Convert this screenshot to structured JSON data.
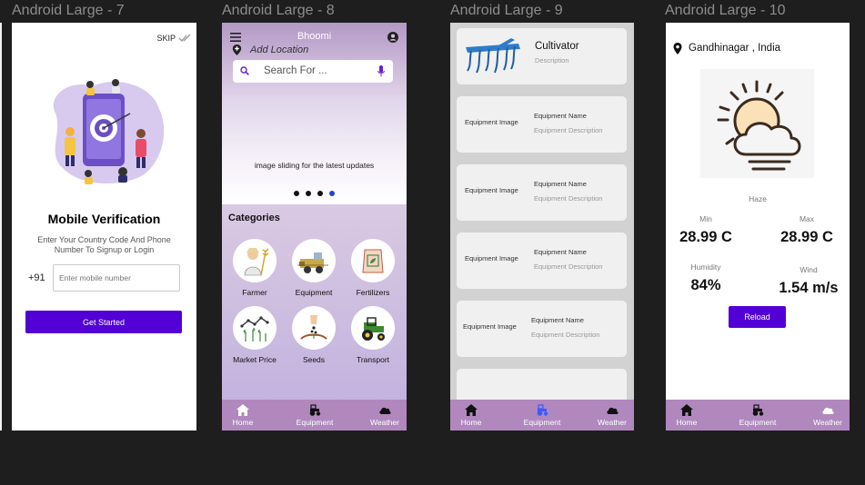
{
  "frames": {
    "f7": {
      "title": "Android Large - 7"
    },
    "f8": {
      "title": "Android Large - 8"
    },
    "f9": {
      "title": "Android Large - 9"
    },
    "f10": {
      "title": "Android Large - 10"
    }
  },
  "verification": {
    "skip_label": "SKIP",
    "heading": "Mobile Verification",
    "subtitle": "Enter Your Country Code And Phone Number To Signup or Login",
    "country_code": "+91",
    "mobile_placeholder": "Enter mobile number",
    "cta_label": "Get Started",
    "accent_color": "#5200d6"
  },
  "home": {
    "app_name": "Bhoomi",
    "add_location": "Add Location",
    "search_placeholder": "Search For ...",
    "slider_text": "image sliding for the latest updates",
    "slider_dots": 4,
    "slider_active_dot": 4,
    "categories_title": "Categories",
    "categories": [
      {
        "label": "Farmer",
        "icon": "farmer-icon"
      },
      {
        "label": "Equipment",
        "icon": "harvester-icon"
      },
      {
        "label": "Fertilizers",
        "icon": "fertilizer-bag-icon"
      },
      {
        "label": "Market Price",
        "icon": "market-chart-icon"
      },
      {
        "label": "Seeds",
        "icon": "seeds-icon"
      },
      {
        "label": "Transport",
        "icon": "tractor-icon"
      }
    ]
  },
  "nav": {
    "home": "Home",
    "equipment": "Equipment",
    "weather": "Weather",
    "active_color": "#3d5afe"
  },
  "equipment_list": {
    "featured": {
      "name": "Cultivator",
      "description": "Description"
    },
    "items": [
      {
        "image": "Equipment Image",
        "name": "Equipment Name",
        "description": "Equipment Description"
      },
      {
        "image": "Equipment Image",
        "name": "Equipment Name",
        "description": "Equipment Description"
      },
      {
        "image": "Equipment Image",
        "name": "Equipment Name",
        "description": "Equipment Description"
      },
      {
        "image": "Equipment Image",
        "name": "Equipment Name",
        "description": "Equipment Description"
      }
    ]
  },
  "weather": {
    "location": "Gandhinagar , India",
    "condition": "Haze",
    "min_label": "Min",
    "min_value": "28.99 C",
    "max_label": "Max",
    "max_value": "28.99 C",
    "humidity_label": "Humidity",
    "humidity_value": "84%",
    "wind_label": "Wind",
    "wind_value": "1.54 m/s",
    "reload_label": "Reload"
  }
}
